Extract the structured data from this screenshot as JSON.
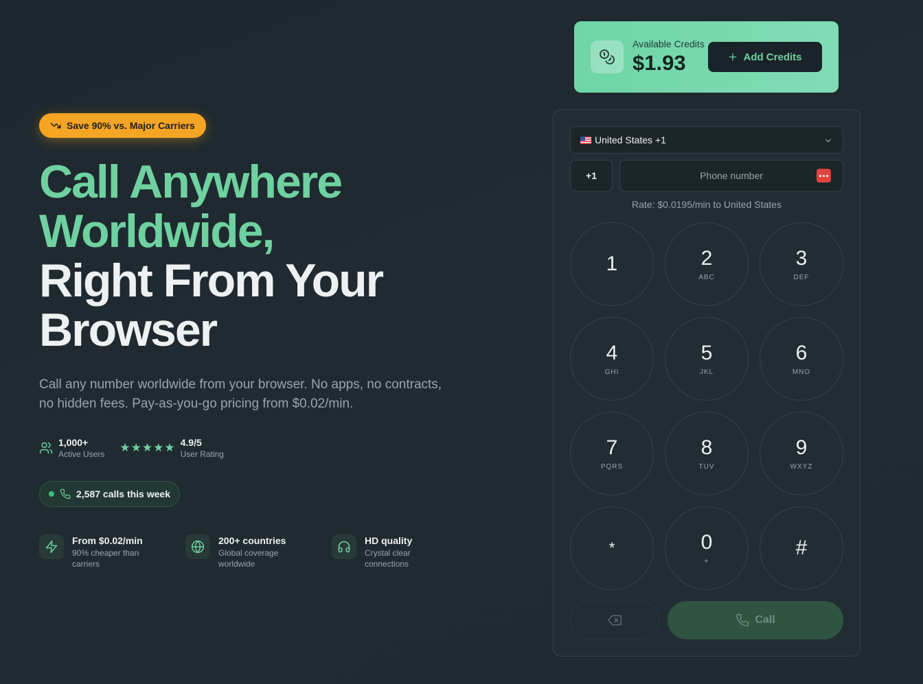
{
  "hero": {
    "badge": "Save 90% vs. Major Carriers",
    "headline_green_1": "Call Anywhere",
    "headline_green_2": "Worldwide,",
    "headline_white_1": "Right From Your",
    "headline_white_2": "Browser",
    "subtitle": "Call any number worldwide from your browser. No apps, no contracts, no hidden fees. Pay-as-you-go pricing from $0.02/min.",
    "stats": {
      "users_value": "1,000+",
      "users_label": "Active Users",
      "rating_value": "4.9/5",
      "rating_label": "User Rating",
      "stars": 5
    },
    "calls_pill": "2,587 calls this week",
    "features": [
      {
        "icon": "lightning-icon",
        "title": "From $0.02/min",
        "desc": "90% cheaper than carriers"
      },
      {
        "icon": "globe-icon",
        "title": "200+ countries",
        "desc": "Global coverage worldwide"
      },
      {
        "icon": "headphones-icon",
        "title": "HD quality",
        "desc": "Crystal clear connections"
      }
    ]
  },
  "credits": {
    "label": "Available Credits",
    "amount": "$1.93",
    "add_label": "Add Credits"
  },
  "dialer": {
    "country": "United States +1",
    "country_code": "+1",
    "phone_placeholder": "Phone number",
    "phone_value": "",
    "rate": "Rate: $0.0195/min to United States",
    "keys": [
      {
        "digit": "1",
        "letters": ""
      },
      {
        "digit": "2",
        "letters": "ABC"
      },
      {
        "digit": "3",
        "letters": "DEF"
      },
      {
        "digit": "4",
        "letters": "GHI"
      },
      {
        "digit": "5",
        "letters": "JKL"
      },
      {
        "digit": "6",
        "letters": "MNO"
      },
      {
        "digit": "7",
        "letters": "PQRS"
      },
      {
        "digit": "8",
        "letters": "TUV"
      },
      {
        "digit": "9",
        "letters": "WXYZ"
      },
      {
        "digit": "*",
        "letters": ""
      },
      {
        "digit": "0",
        "letters": "+"
      },
      {
        "digit": "#",
        "letters": ""
      }
    ],
    "call_label": "Call"
  },
  "colors": {
    "accent": "#6fd1a0",
    "badge": "#f5a524",
    "background": "#1f2a30",
    "call_button": "#2f5442"
  }
}
